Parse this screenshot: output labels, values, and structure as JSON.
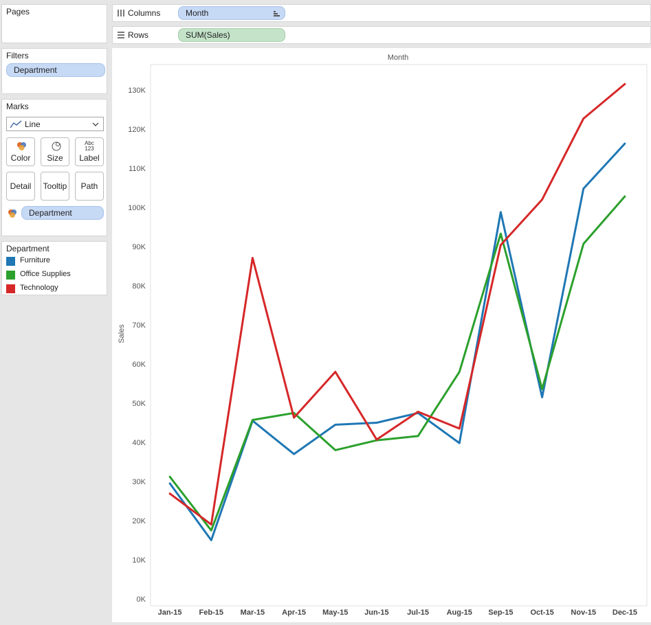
{
  "pages": {
    "title": "Pages"
  },
  "filters": {
    "title": "Filters",
    "pill": "Department"
  },
  "marks": {
    "title": "Marks",
    "mark_type": "Line",
    "buttons": {
      "color": "Color",
      "size": "Size",
      "label": "Label",
      "detail": "Detail",
      "tooltip": "Tooltip",
      "path": "Path"
    },
    "label_icon_text": {
      "top": "Abc",
      "bottom": "123"
    },
    "color_pill": "Department"
  },
  "legend": {
    "title": "Department",
    "items": [
      {
        "label": "Furniture",
        "color": "#1f77b4"
      },
      {
        "label": "Office Supplies",
        "color": "#2ca02c"
      },
      {
        "label": "Technology",
        "color": "#d62728"
      }
    ]
  },
  "shelves": {
    "columns": {
      "label": "Columns",
      "pill": "Month"
    },
    "rows": {
      "label": "Rows",
      "pill": "SUM(Sales)"
    }
  },
  "chart_data": {
    "type": "line",
    "title": "Month",
    "xlabel": "",
    "ylabel": "Sales",
    "categories": [
      "Jan-15",
      "Feb-15",
      "Mar-15",
      "Apr-15",
      "May-15",
      "Jun-15",
      "Jul-15",
      "Aug-15",
      "Sep-15",
      "Oct-15",
      "Nov-15",
      "Dec-15"
    ],
    "ylim": [
      0,
      135000
    ],
    "yticks": [
      0,
      10000,
      20000,
      30000,
      40000,
      50000,
      60000,
      70000,
      80000,
      90000,
      100000,
      110000,
      120000,
      130000
    ],
    "ytick_labels": [
      "0K",
      "10K",
      "20K",
      "30K",
      "40K",
      "50K",
      "60K",
      "70K",
      "80K",
      "90K",
      "100K",
      "110K",
      "120K",
      "130K"
    ],
    "grid": false,
    "series": [
      {
        "name": "Furniture",
        "color": "#1f77b4",
        "values": [
          29500,
          15000,
          45500,
          37000,
          44500,
          45000,
          47500,
          39800,
          98800,
          51500,
          104800,
          116300
        ]
      },
      {
        "name": "Office Supplies",
        "color": "#2ca02c",
        "values": [
          31200,
          17500,
          45700,
          47500,
          38000,
          40500,
          41600,
          58000,
          93300,
          53600,
          90700,
          102800
        ]
      },
      {
        "name": "Technology",
        "color": "#d62728",
        "values": [
          26900,
          19000,
          87100,
          46300,
          58000,
          40700,
          47800,
          43500,
          90400,
          102000,
          122700,
          131500
        ]
      }
    ]
  }
}
